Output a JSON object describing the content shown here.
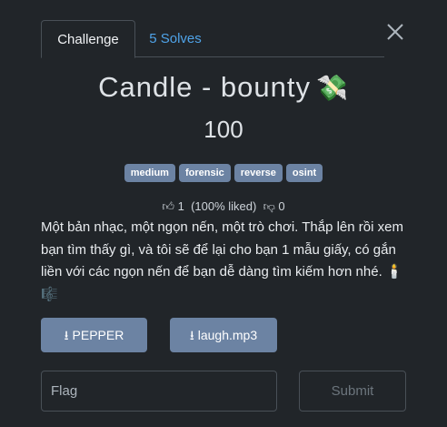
{
  "tabs": [
    {
      "label": "Challenge"
    },
    {
      "label": "5 Solves"
    }
  ],
  "challenge": {
    "name": "Candle - bounty",
    "title_emoji": "💸",
    "points": "100",
    "tags": [
      "medium",
      "forensic",
      "reverse",
      "osint"
    ]
  },
  "votes": {
    "likes": "1",
    "liked_pct": "(100% liked)",
    "dislikes": "0"
  },
  "description": "Một bản nhạc, một ngọn nến, một trò chơi. Thắp lên rồi xem bạn tìm thấy gì, và tôi sẽ để lại cho bạn 1 mẫu giấy, có gắn liền với các ngọn nến để bạn dễ dàng tìm kiếm hơn nhé. 🕯️ 🎼",
  "files": [
    {
      "label": "PEPPER"
    },
    {
      "label": "laugh.mp3"
    }
  ],
  "submission": {
    "flag_placeholder": "Flag",
    "flag_value": "",
    "submit_label": "Submit"
  },
  "icons": {
    "close": "close-icon",
    "like": "thumbs-up-icon",
    "dislike": "thumbs-down-icon",
    "download": "download-icon"
  },
  "colors": {
    "background": "#212529",
    "tag_bg": "#6c83a3",
    "link": "#4fa3e8"
  }
}
